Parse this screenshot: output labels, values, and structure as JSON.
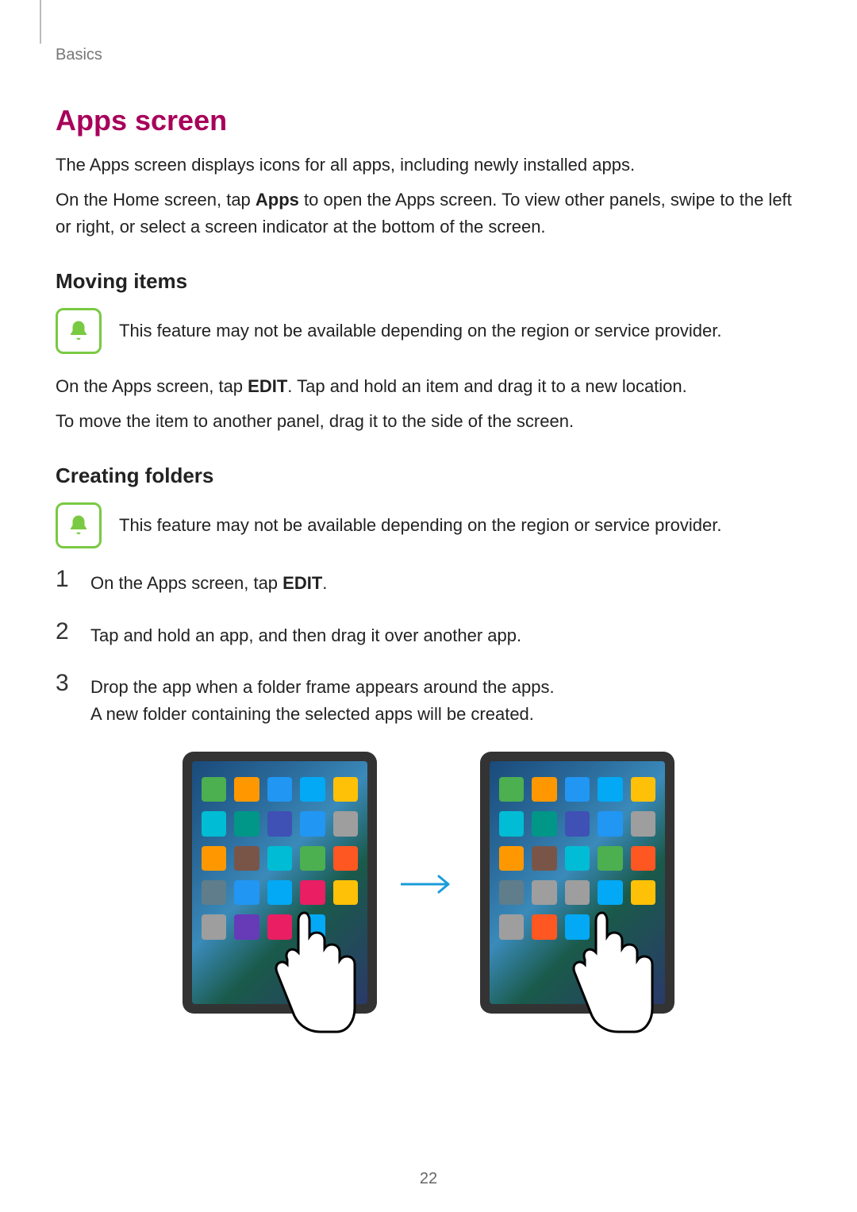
{
  "header": {
    "section": "Basics"
  },
  "title": "Apps screen",
  "intro": {
    "p1": "The Apps screen displays icons for all apps, including newly installed apps.",
    "p2_pre": "On the Home screen, tap ",
    "p2_bold": "Apps",
    "p2_post": " to open the Apps screen. To view other panels, swipe to the left or right, or select a screen indicator at the bottom of the screen."
  },
  "moving": {
    "heading": "Moving items",
    "note": "This feature may not be available depending on the region or service provider.",
    "p1_pre": "On the Apps screen, tap ",
    "p1_bold": "EDIT",
    "p1_post": ". Tap and hold an item and drag it to a new location.",
    "p2": "To move the item to another panel, drag it to the side of the screen."
  },
  "creating": {
    "heading": "Creating folders",
    "note": "This feature may not be available depending on the region or service provider.",
    "step1_pre": "On the Apps screen, tap ",
    "step1_bold": "EDIT",
    "step1_post": ".",
    "step2": "Tap and hold an app, and then drag it over another app.",
    "step3a": "Drop the app when a folder frame appears around the apps.",
    "step3b": "A new folder containing the selected apps will be created."
  },
  "nums": {
    "n1": "1",
    "n2": "2",
    "n3": "3"
  },
  "page_number": "22"
}
